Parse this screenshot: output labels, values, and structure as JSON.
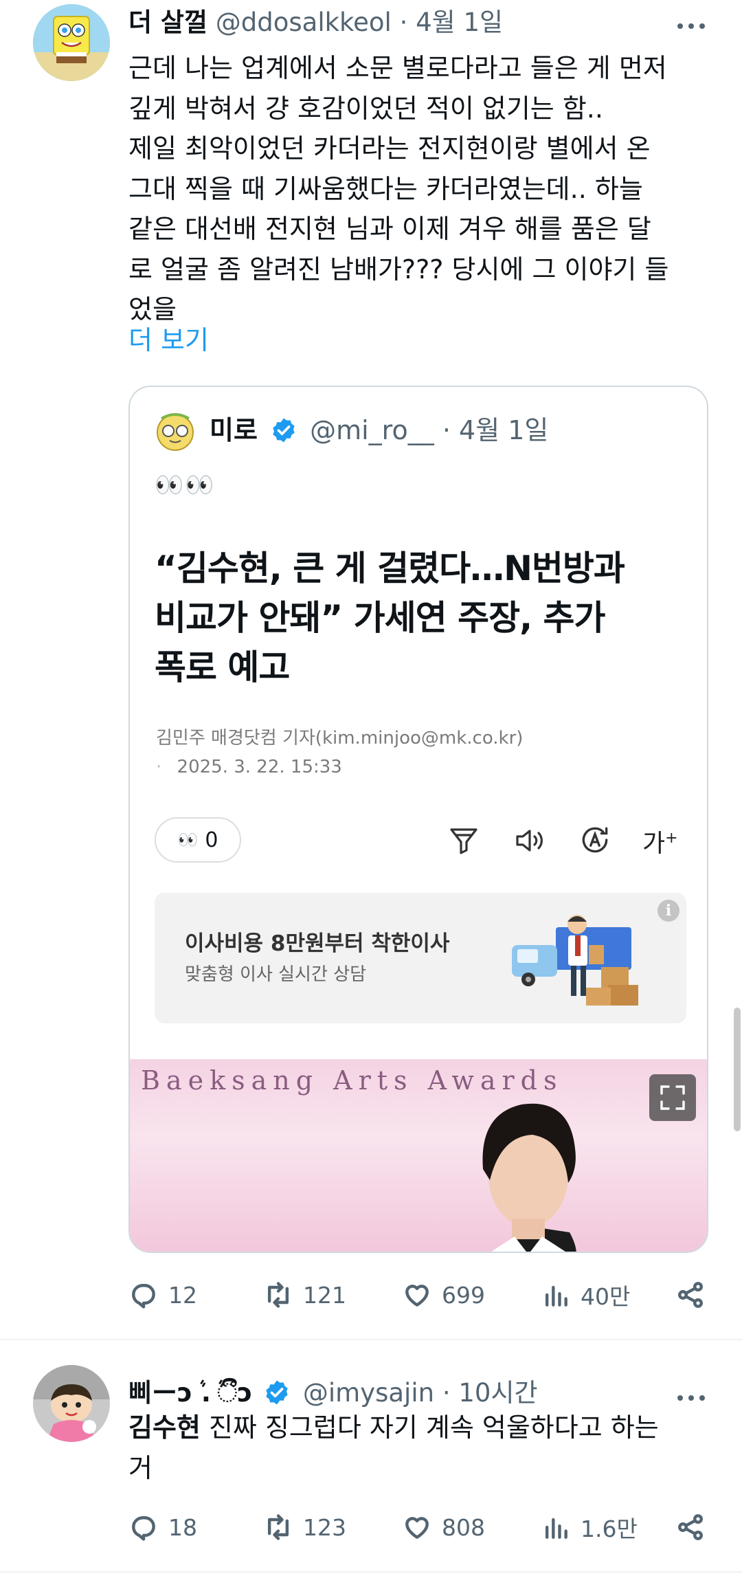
{
  "post1": {
    "name": "더 살껄",
    "handle": "@ddosalkkeol",
    "dot": "·",
    "time": "4월 1일",
    "lines": [
      "근데 나는 업계에서 소문 별로다라고 들은 게 먼저",
      "깊게 박혀서 걍 호감이었던 적이 없기는 함..",
      "제일 최악이었던 카더라는 전지현이랑 별에서 온",
      "그대 찍을 때 기싸움했다는 카더라였는데.. 하늘",
      "같은 대선배 전지현 님과 이제 겨우 해를 품은 달",
      "로 얼굴 좀 알려진 남배가??? 당시에 그 이야기 들",
      "었을"
    ],
    "show_more": "더 보기",
    "quote": {
      "name": "미로",
      "handle": "@mi_ro__",
      "dot": "·",
      "time": "4월 1일",
      "emoji": "👀👀",
      "article": {
        "headline": [
          "“김수현, 큰 게 걸렸다…N번방과",
          "비교가 안돼” 가세연 주장, 추가",
          "폭로 예고"
        ],
        "byline": "김민주 매경닷컴 기자(kim.minjoo@mk.co.kr)",
        "date": "2025. 3. 22. 15:33",
        "reaction_count": "0",
        "font_label": "가",
        "ad": {
          "title": "이사비용 8만원부터 착한이사",
          "subtitle": "맞춤형 이사 실시간 상담"
        },
        "photo_text": "Baeksang Arts Awards"
      }
    },
    "actions": {
      "replies": "12",
      "reposts": "121",
      "likes": "699",
      "views": "40만"
    }
  },
  "post2": {
    "name": "삐ーↄܵ . ܵීↄ",
    "handle": "@imysajin",
    "dot": "·",
    "time": "10시간",
    "highlight": "김수현",
    "line1_rest": " 진짜 징그럽다 자기 계속 억울하다고 하는",
    "line2": "거",
    "actions": {
      "replies": "18",
      "reposts": "123",
      "likes": "808",
      "views": "1.6만"
    }
  },
  "colors": {
    "link": "#1d9bf0",
    "verified": "#1d9bf0",
    "secondary": "#536471",
    "border": "#cfd9de"
  },
  "icons": [
    "reply-icon",
    "repost-icon",
    "like-icon",
    "views-icon",
    "share-icon",
    "verified-badge-icon",
    "more-icon",
    "expand-icon",
    "info-icon",
    "filter-icon",
    "speaker-icon",
    "translate-icon"
  ]
}
